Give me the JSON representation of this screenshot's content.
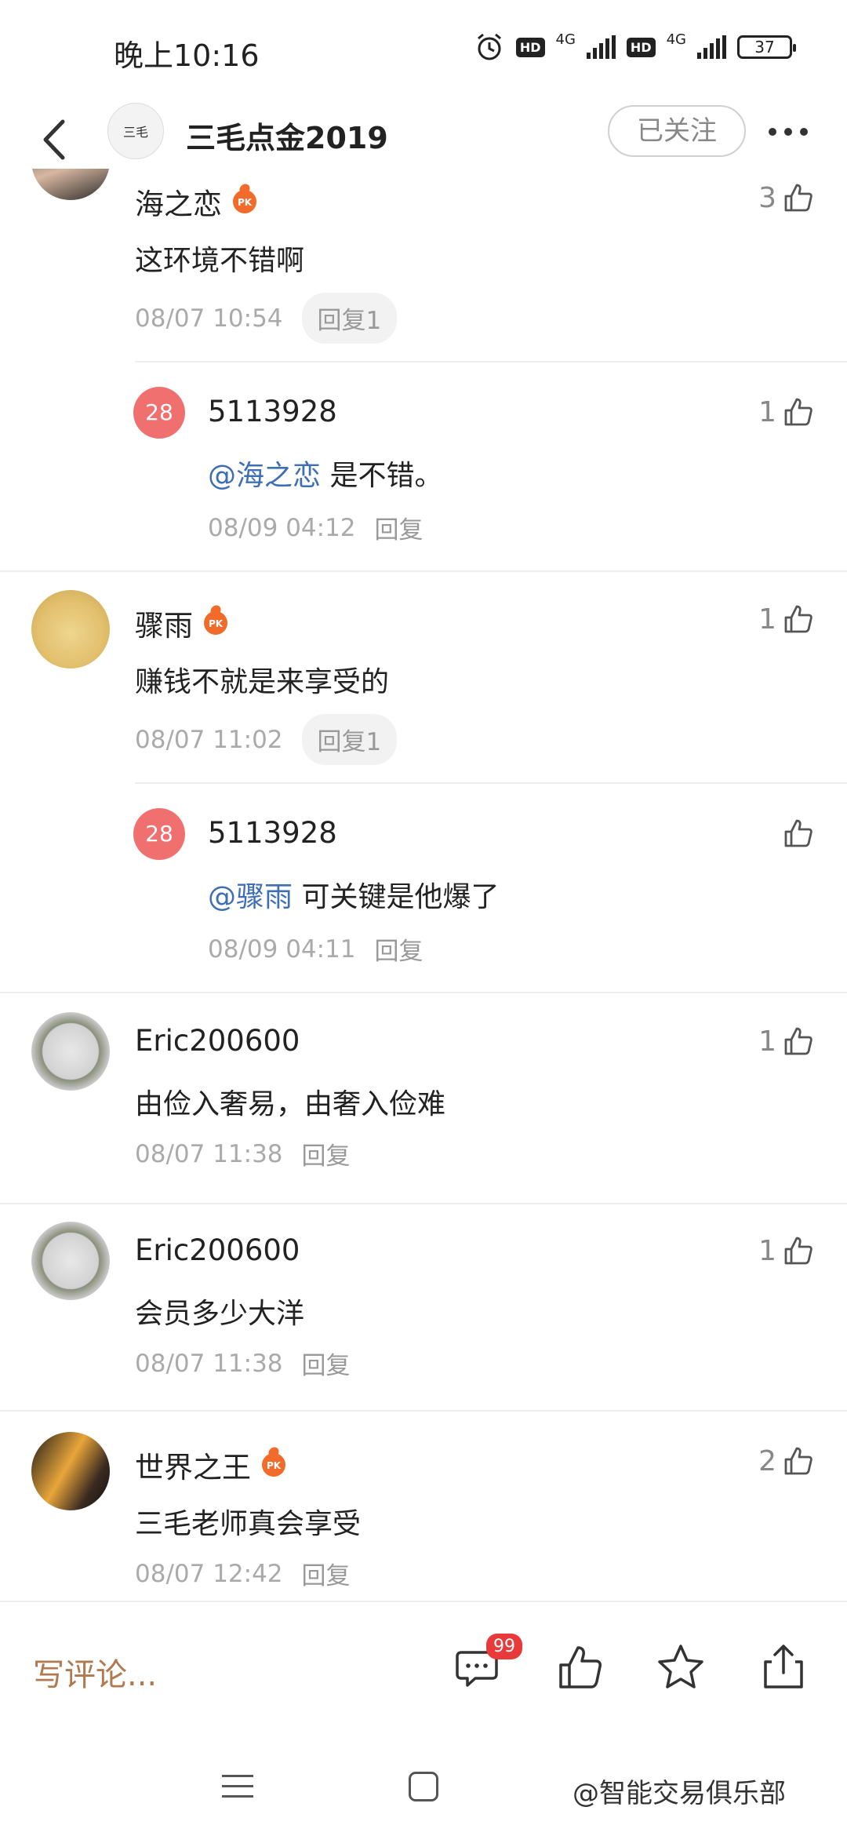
{
  "status_bar": {
    "time": "晚上10:16",
    "hd1": "HD",
    "net1": "4G",
    "hd2": "HD",
    "net2": "4G",
    "battery": "37"
  },
  "header": {
    "avatar_text": "三毛",
    "title": "三毛点金2019",
    "follow_label": "已关注"
  },
  "comments": [
    {
      "name": "海之恋",
      "has_pk": true,
      "pk_label": "PK",
      "text": "这环境不错啊",
      "time": "08/07 10:54",
      "reply_label": "回复1",
      "likes": "3",
      "replies": [
        {
          "avatar_num": "28",
          "name": "5113928",
          "mention": "@海之恋",
          "text": " 是不错。",
          "time": "08/09 04:12",
          "reply_label": "回复",
          "likes": "1"
        }
      ]
    },
    {
      "name": "骤雨",
      "has_pk": true,
      "pk_label": "PK",
      "text": "赚钱不就是来享受的",
      "time": "08/07 11:02",
      "reply_label": "回复1",
      "likes": "1",
      "replies": [
        {
          "avatar_num": "28",
          "name": "5113928",
          "mention": "@骤雨",
          "text": " 可关键是他爆了",
          "time": "08/09 04:11",
          "reply_label": "回复",
          "likes": ""
        }
      ]
    },
    {
      "name": "Eric200600",
      "text": "由俭入奢易，由奢入俭难",
      "time": "08/07 11:38",
      "reply_label": "回复",
      "likes": "1"
    },
    {
      "name": "Eric200600",
      "text": "会员多少大洋",
      "time": "08/07 11:38",
      "reply_label": "回复",
      "likes": "1"
    },
    {
      "name": "世界之王",
      "has_pk": true,
      "pk_label": "PK",
      "text": "三毛老师真会享受",
      "time": "08/07 12:42",
      "reply_label": "回复",
      "likes": "2"
    }
  ],
  "bottom_bar": {
    "write_placeholder": "写评论...",
    "comment_count_badge": "99"
  },
  "watermark": "@智能交易俱乐部",
  "colors": {
    "mention": "#3e6fb5",
    "pk_badge": "#f26b2a",
    "number_avatar": "#f07070",
    "badge": "#e83a3a",
    "write_text": "#b07a50"
  }
}
